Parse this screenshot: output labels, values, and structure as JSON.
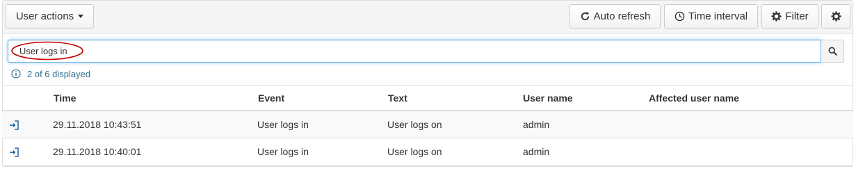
{
  "toolbar": {
    "user_actions_label": "User actions",
    "auto_refresh_label": "Auto refresh",
    "time_interval_label": "Time interval",
    "filter_label": "Filter",
    "settings_icon": "gear-icon"
  },
  "search": {
    "value": "User logs in",
    "highlight_color": "#c00000"
  },
  "result_count": "2 of 6 displayed",
  "table": {
    "columns": [
      "Time",
      "Event",
      "Text",
      "User name",
      "Affected user name"
    ],
    "rows": [
      {
        "time": "29.11.2018 10:43:51",
        "event": "User logs in",
        "text": "User logs on",
        "user": "admin",
        "affected": ""
      },
      {
        "time": "29.11.2018 10:40:01",
        "event": "User logs in",
        "text": "User logs on",
        "user": "admin",
        "affected": ""
      }
    ]
  },
  "colors": {
    "accent": "#31708f",
    "icon_blue": "#2e6da4"
  }
}
